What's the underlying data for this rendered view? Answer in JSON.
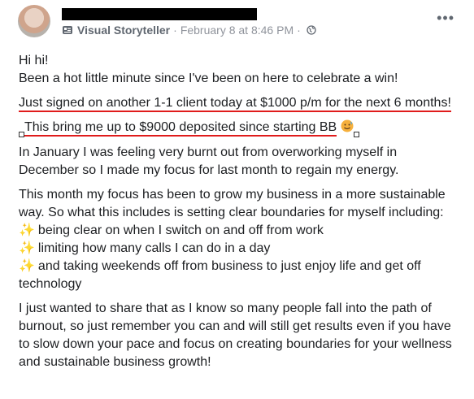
{
  "post": {
    "author_name": "",
    "role": "Visual Storyteller",
    "separator": "·",
    "date": "February 8 at 8:46 PM",
    "more_label": "•••",
    "icons": {
      "badge": "badge-icon",
      "privacy": "globe-icon",
      "menu": "more-options-icon"
    },
    "accent_underline": "#e01b1b",
    "paragraphs": {
      "p1": "Hi hi!",
      "p2": "Been a hot little minute since I've been on here to celebrate a win!",
      "p3": "Just signed on another 1-1 client today at $1000 p/m for the next 6 months!",
      "p4": "This bring me up to $9000 deposited since starting BB",
      "p5": "In January I was feeling very burnt out from overworking myself in December so I made my focus for last month to regain my energy.",
      "p6": "This month my focus has been to grow my business in a more sustainable way. So what this includes is setting clear boundaries for myself including:",
      "bullets": [
        "being clear on when I switch on and off from work",
        "limiting how many calls I can do in a day",
        "and taking weekends off from business to just enjoy life and get off technology"
      ],
      "p7": "I just wanted to share that as I know so many people fall into the path of burnout, so just remember you can and will still get results even if you have to slow down your pace and focus on creating boundaries for your wellness and sustainable business growth!"
    }
  }
}
